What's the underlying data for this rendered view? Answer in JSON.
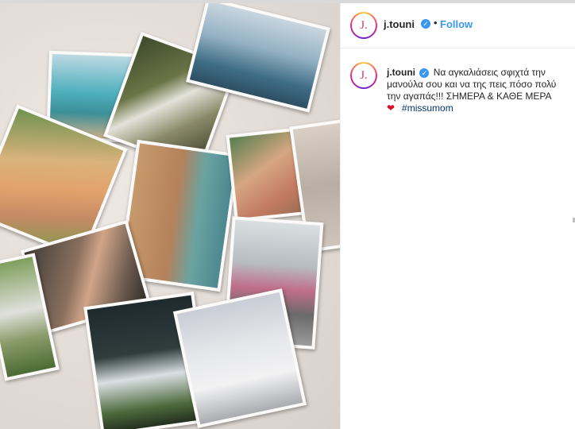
{
  "post": {
    "username": "j.touni",
    "follow_label": "Follow",
    "separator": "•",
    "avatar_letter": "J.",
    "caption": {
      "username": "j.touni",
      "text": "Να αγκαλιάσεις σφιχτά την μανούλα σου και να της πεις πόσο πολύ την αγαπάς!!! ΣΗΜΕΡΑ & ΚΑΘΕ ΜΕΡΑ",
      "emoji_heart": "❤",
      "emoji_small_heart": "♡",
      "hashtag": "#missumom"
    },
    "verified_glyph": "✓"
  },
  "colors": {
    "follow": "#3897f0",
    "verified": "#3897f0",
    "hashtag": "#003569"
  }
}
